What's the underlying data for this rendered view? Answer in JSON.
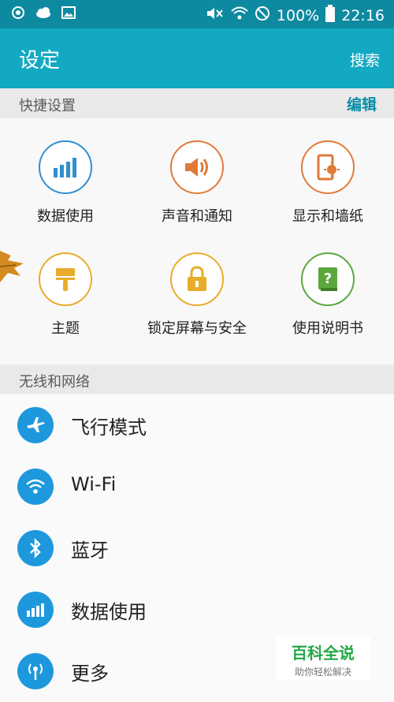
{
  "statusbar": {
    "battery": "100%",
    "time": "22:16"
  },
  "appbar": {
    "title": "设定",
    "search_label": "搜索"
  },
  "quick_settings": {
    "header": "快捷设置",
    "edit_label": "编辑",
    "items": [
      {
        "label": "数据使用",
        "icon": "data-usage-icon",
        "color": "#2f8fd0"
      },
      {
        "label": "声音和通知",
        "icon": "sound-icon",
        "color": "#e07a3a"
      },
      {
        "label": "显示和墙纸",
        "icon": "display-icon",
        "color": "#e07a3a"
      },
      {
        "label": "主题",
        "icon": "theme-brush-icon",
        "color": "#e8ac2a"
      },
      {
        "label": "锁定屏幕与安全",
        "icon": "lock-icon",
        "color": "#e8ac2a"
      },
      {
        "label": "使用说明书",
        "icon": "manual-icon",
        "color": "#5aa83c"
      }
    ]
  },
  "wireless": {
    "header": "无线和网络",
    "items": [
      {
        "label": "飞行模式",
        "icon": "airplane-icon"
      },
      {
        "label": "Wi-Fi",
        "icon": "wifi-icon"
      },
      {
        "label": "蓝牙",
        "icon": "bluetooth-icon"
      },
      {
        "label": "数据使用",
        "icon": "data-usage-icon"
      },
      {
        "label": "更多",
        "icon": "more-connections-icon"
      }
    ]
  },
  "watermark": {
    "title": "百科全说",
    "subtitle": "助你轻松解决"
  }
}
